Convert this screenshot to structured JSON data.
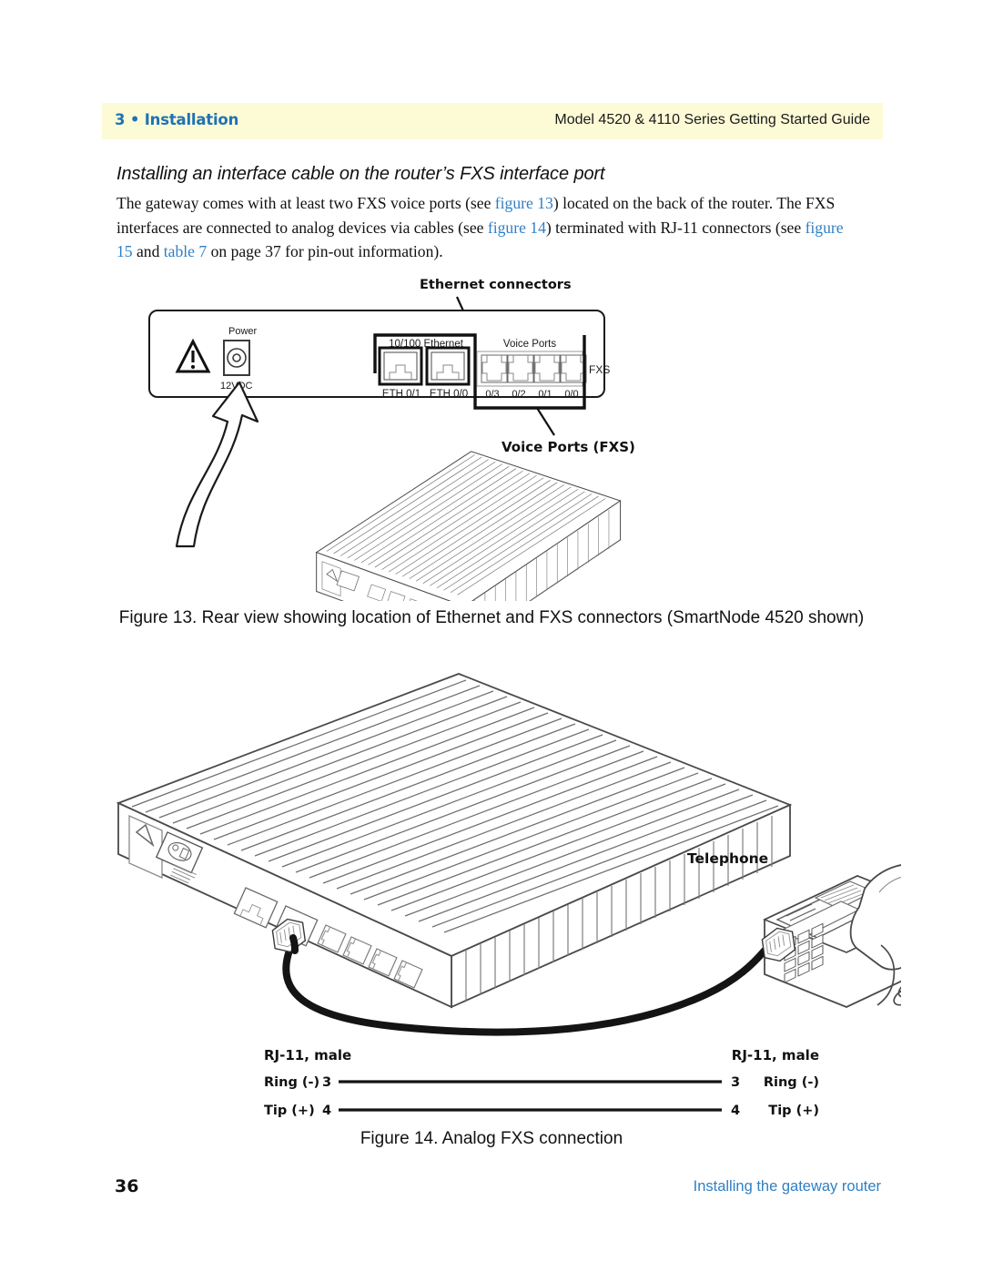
{
  "header": {
    "chapter": "3 • Installation",
    "guide_title": "Model 4520 & 4110 Series Getting Started Guide",
    "band_color": "#fdfbd6",
    "accent_color": "#1f72b5"
  },
  "section": {
    "title": "Installing an interface cable on the router’s FXS interface port",
    "paragraph": {
      "part1": "The gateway comes with at least two FXS voice ports (see ",
      "xref1": "figure 13",
      "part2": ") located on the back of the router. The FXS interfaces are connected to analog devices via cables (see ",
      "xref2": "figure 14",
      "part3": ") terminated with RJ-11 connectors (see ",
      "xref3": "figure 15",
      "part4": " and ",
      "xref4": "table 7",
      "part5": " on page 37 for pin-out information)."
    }
  },
  "figure13": {
    "caption": "Figure 13. Rear view showing location of Ethernet and FXS connectors (SmartNode 4520 shown)",
    "callout_ethernet": "Ethernet connectors",
    "callout_voice": "Voice Ports (FXS)",
    "panel": {
      "power_label": "Power",
      "power_rating": "12VDC",
      "ethernet_group": "10/100 Ethernet",
      "voice_group": "Voice Ports",
      "fxs_label": "FXS",
      "eth_ports": [
        "ETH 0/1",
        "ETH 0/0"
      ],
      "voice_ports": [
        "0/3",
        "0/2",
        "0/1",
        "0/0"
      ]
    }
  },
  "figure14": {
    "caption": "Figure 14. Analog FXS connection",
    "telephone_label": "Telephone"
  },
  "pinout": {
    "left_title": "RJ-11, male",
    "right_title": "RJ-11, male",
    "rows": [
      {
        "left_label": "Ring (-)",
        "left_pin": "3",
        "right_pin": "3",
        "right_label": "Ring (-)"
      },
      {
        "left_label": "Tip (+)",
        "left_pin": "4",
        "right_pin": "4",
        "right_label": "Tip (+)"
      }
    ]
  },
  "footer": {
    "page_number": "36",
    "section_name": "Installing the gateway router",
    "link_color": "#2f7fc4"
  }
}
